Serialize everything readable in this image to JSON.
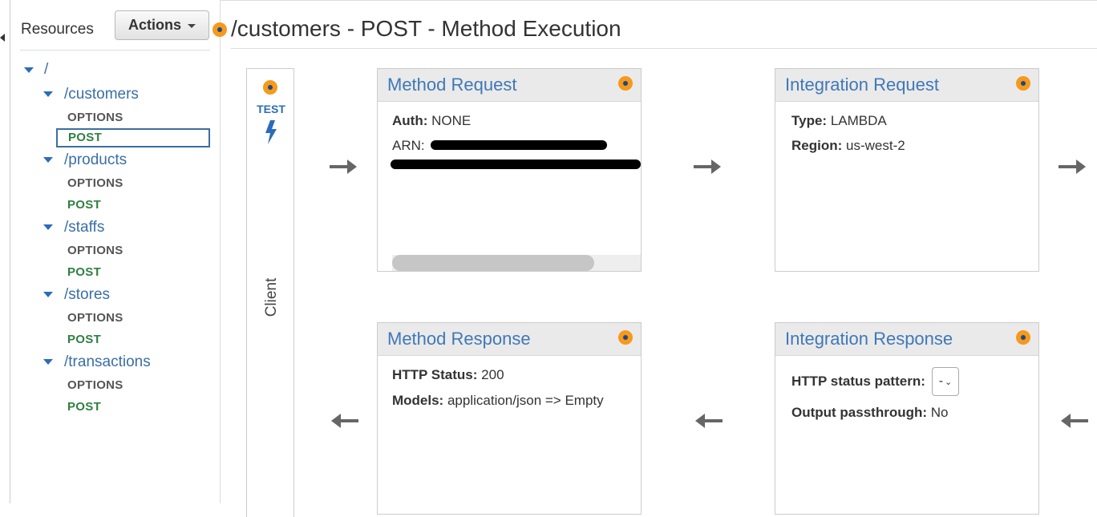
{
  "sidebar": {
    "title": "Resources",
    "actions_label": "Actions",
    "root": "/",
    "resources": [
      {
        "path": "/customers",
        "methods": [
          "OPTIONS",
          "POST"
        ]
      },
      {
        "path": "/products",
        "methods": [
          "OPTIONS",
          "POST"
        ]
      },
      {
        "path": "/staffs",
        "methods": [
          "OPTIONS",
          "POST"
        ]
      },
      {
        "path": "/stores",
        "methods": [
          "OPTIONS",
          "POST"
        ]
      },
      {
        "path": "/transactions",
        "methods": [
          "OPTIONS",
          "POST"
        ]
      }
    ],
    "selected": "/customers POST"
  },
  "header": {
    "title": "/customers - POST - Method Execution"
  },
  "client": {
    "test_label": "TEST",
    "label": "Client"
  },
  "method_request": {
    "title": "Method Request",
    "auth_label": "Auth:",
    "auth_value": "NONE",
    "arn_label": "ARN:"
  },
  "integration_request": {
    "title": "Integration Request",
    "type_label": "Type:",
    "type_value": "LAMBDA",
    "region_label": "Region:",
    "region_value": "us-west-2"
  },
  "method_response": {
    "title": "Method Response",
    "status_label": "HTTP Status:",
    "status_value": "200",
    "models_label": "Models:",
    "models_value": "application/json => Empty"
  },
  "integration_response": {
    "title": "Integration Response",
    "pattern_label": "HTTP status pattern:",
    "pattern_value": "-",
    "passthrough_label": "Output passthrough:",
    "passthrough_value": "No"
  },
  "colors": {
    "accent_blue": "#3f78b8",
    "dot_orange": "#f7991c",
    "post_green": "#2f8040"
  }
}
